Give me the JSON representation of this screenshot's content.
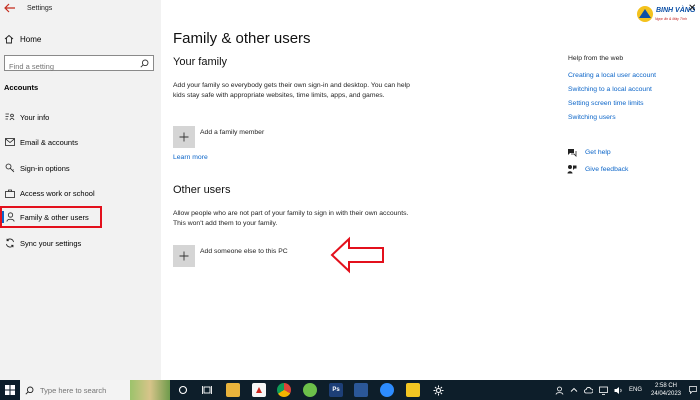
{
  "window": {
    "title": "Settings",
    "close_glyph": "✕"
  },
  "sidebar": {
    "home_label": "Home",
    "search_placeholder": "Find a setting",
    "section_title": "Accounts",
    "items": [
      {
        "label": "Your info",
        "icon": "contact-card-icon"
      },
      {
        "label": "Email & accounts",
        "icon": "mail-icon"
      },
      {
        "label": "Sign-in options",
        "icon": "key-icon"
      },
      {
        "label": "Access work or school",
        "icon": "briefcase-icon"
      },
      {
        "label": "Family & other users",
        "icon": "person-icon",
        "selected": true
      },
      {
        "label": "Sync your settings",
        "icon": "sync-icon"
      }
    ]
  },
  "main": {
    "title": "Family & other users",
    "family": {
      "heading": "Your family",
      "description": "Add your family so everybody gets their own sign-in and desktop. You can help kids stay safe with appropriate websites, time limits, apps, and games.",
      "add_label": "Add a family member",
      "learn_more": "Learn more"
    },
    "other": {
      "heading": "Other users",
      "description": "Allow people who are not part of your family to sign in with their own accounts. This won't add them to your family.",
      "add_label": "Add someone else to this PC"
    }
  },
  "help": {
    "title": "Help from the web",
    "links": [
      "Creating a local user account",
      "Switching to a local account",
      "Setting screen time limits",
      "Switching users"
    ],
    "get_help": "Get help",
    "give_feedback": "Give feedback"
  },
  "logo": {
    "brand": "BINH VÀNG",
    "tagline": "Ngọc ấn & Máy Tính"
  },
  "taskbar": {
    "search_placeholder": "Type here to search",
    "language": "ENG",
    "time": "2:58 CH",
    "date": "24/04/2023"
  },
  "colors": {
    "accent": "#0a64c8",
    "highlight_box": "#e3101c",
    "arrow": "#e3101c",
    "taskbar": "#0d1e2a"
  }
}
